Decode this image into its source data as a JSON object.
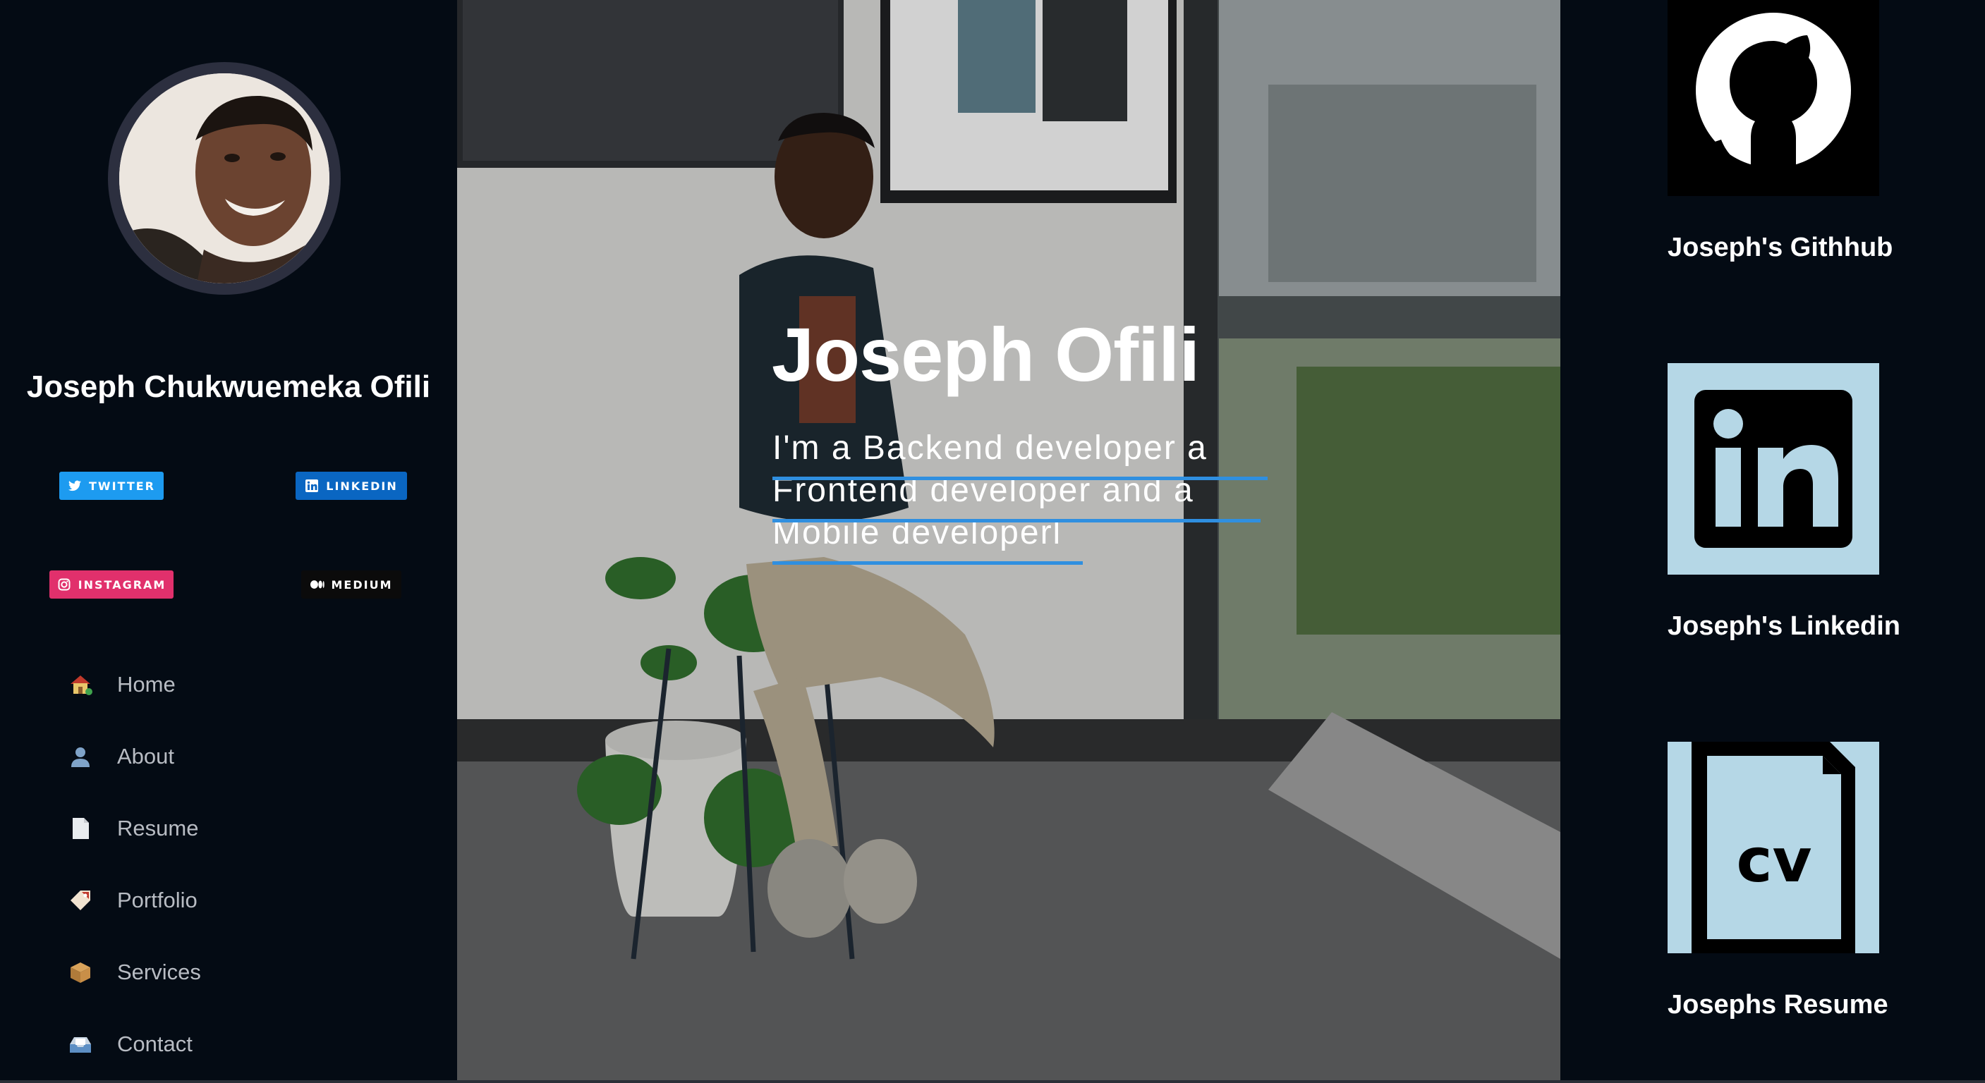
{
  "profile": {
    "name": "Joseph Chukwuemeka Ofili"
  },
  "social": {
    "twitter": {
      "label": "TWITTER",
      "color": "#1d9bf0",
      "icon": "twitter-icon"
    },
    "linkedin": {
      "label": "LINKEDIN",
      "color": "#0a66c2",
      "icon": "linkedin-icon"
    },
    "instagram": {
      "label": "INSTAGRAM",
      "color": "#e1306c",
      "icon": "instagram-icon"
    },
    "medium": {
      "label": "MEDIUM",
      "color": "#0b0b0b",
      "icon": "medium-icon"
    }
  },
  "nav": {
    "items": [
      {
        "label": "Home",
        "icon": "house-icon"
      },
      {
        "label": "About",
        "icon": "person-icon"
      },
      {
        "label": "Resume",
        "icon": "document-icon"
      },
      {
        "label": "Portfolio",
        "icon": "tag-icon"
      },
      {
        "label": "Services",
        "icon": "package-icon"
      },
      {
        "label": "Contact",
        "icon": "inbox-icon"
      }
    ]
  },
  "hero": {
    "title": "Joseph Ofili",
    "subtitle": "I'm a Backend developer a Frontend developer and a Mobile developerl",
    "underline_color": "#2f8fe0"
  },
  "links": {
    "github": {
      "label": "Joseph's Githhub",
      "icon": "github-icon"
    },
    "linkedin": {
      "label": "Joseph's Linkedin",
      "icon": "linkedin-logo-icon",
      "color": "#b5d7e6"
    },
    "resume": {
      "label": "Josephs Resume",
      "icon": "cv-document-icon",
      "color": "#b5d7e6"
    }
  }
}
